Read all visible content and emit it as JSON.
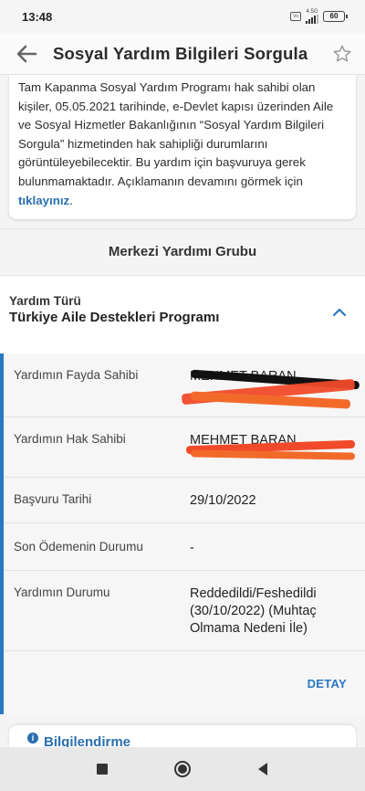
{
  "status": {
    "time": "13:48",
    "network": "4.5G",
    "battery": "60"
  },
  "app_bar": {
    "title": "Sosyal Yardım Bilgileri Sorgula"
  },
  "info": {
    "text": "Tam Kapanma Sosyal Yardım Programı hak sahibi olan kişiler, 05.05.2021 tarihinde, e-Devlet kapısı üzerinden Aile ve Sosyal Hizmetler Bakanlığının “Sosyal Yardım Bilgileri Sorgula” hizmetinden hak sahipliği durumlarını görüntüleyebilecektir. Bu yardım için başvuruya gerek bulunmamaktadır. Açıklamanın devamını görmek için ",
    "link": "tıklayınız",
    "end": "."
  },
  "group": {
    "title": "Merkezi Yardımı Grubu"
  },
  "section": {
    "label": "Yardım Türü",
    "value": "Türkiye Aile Destekleri Programı"
  },
  "details": {
    "rows": [
      {
        "label": "Yardımın Fayda Sahibi",
        "value": "MEHMET BARAN"
      },
      {
        "label": "Yardımın Hak Sahibi",
        "value": "MEHMET BARAN"
      },
      {
        "label": "Başvuru Tarihi",
        "value": "29/10/2022"
      },
      {
        "label": "Son Ödemenin Durumu",
        "value": "-"
      },
      {
        "label": "Yardımın Durumu",
        "value": "Reddedildi/Feshedildi (30/10/2022) (Muhtaç Olmama Nedeni İle)"
      }
    ],
    "button": "DETAY"
  },
  "bilgi": {
    "title": "Bilgilendirme"
  },
  "colors": {
    "accent": "#2a78c4",
    "link": "#2a6fb0"
  }
}
